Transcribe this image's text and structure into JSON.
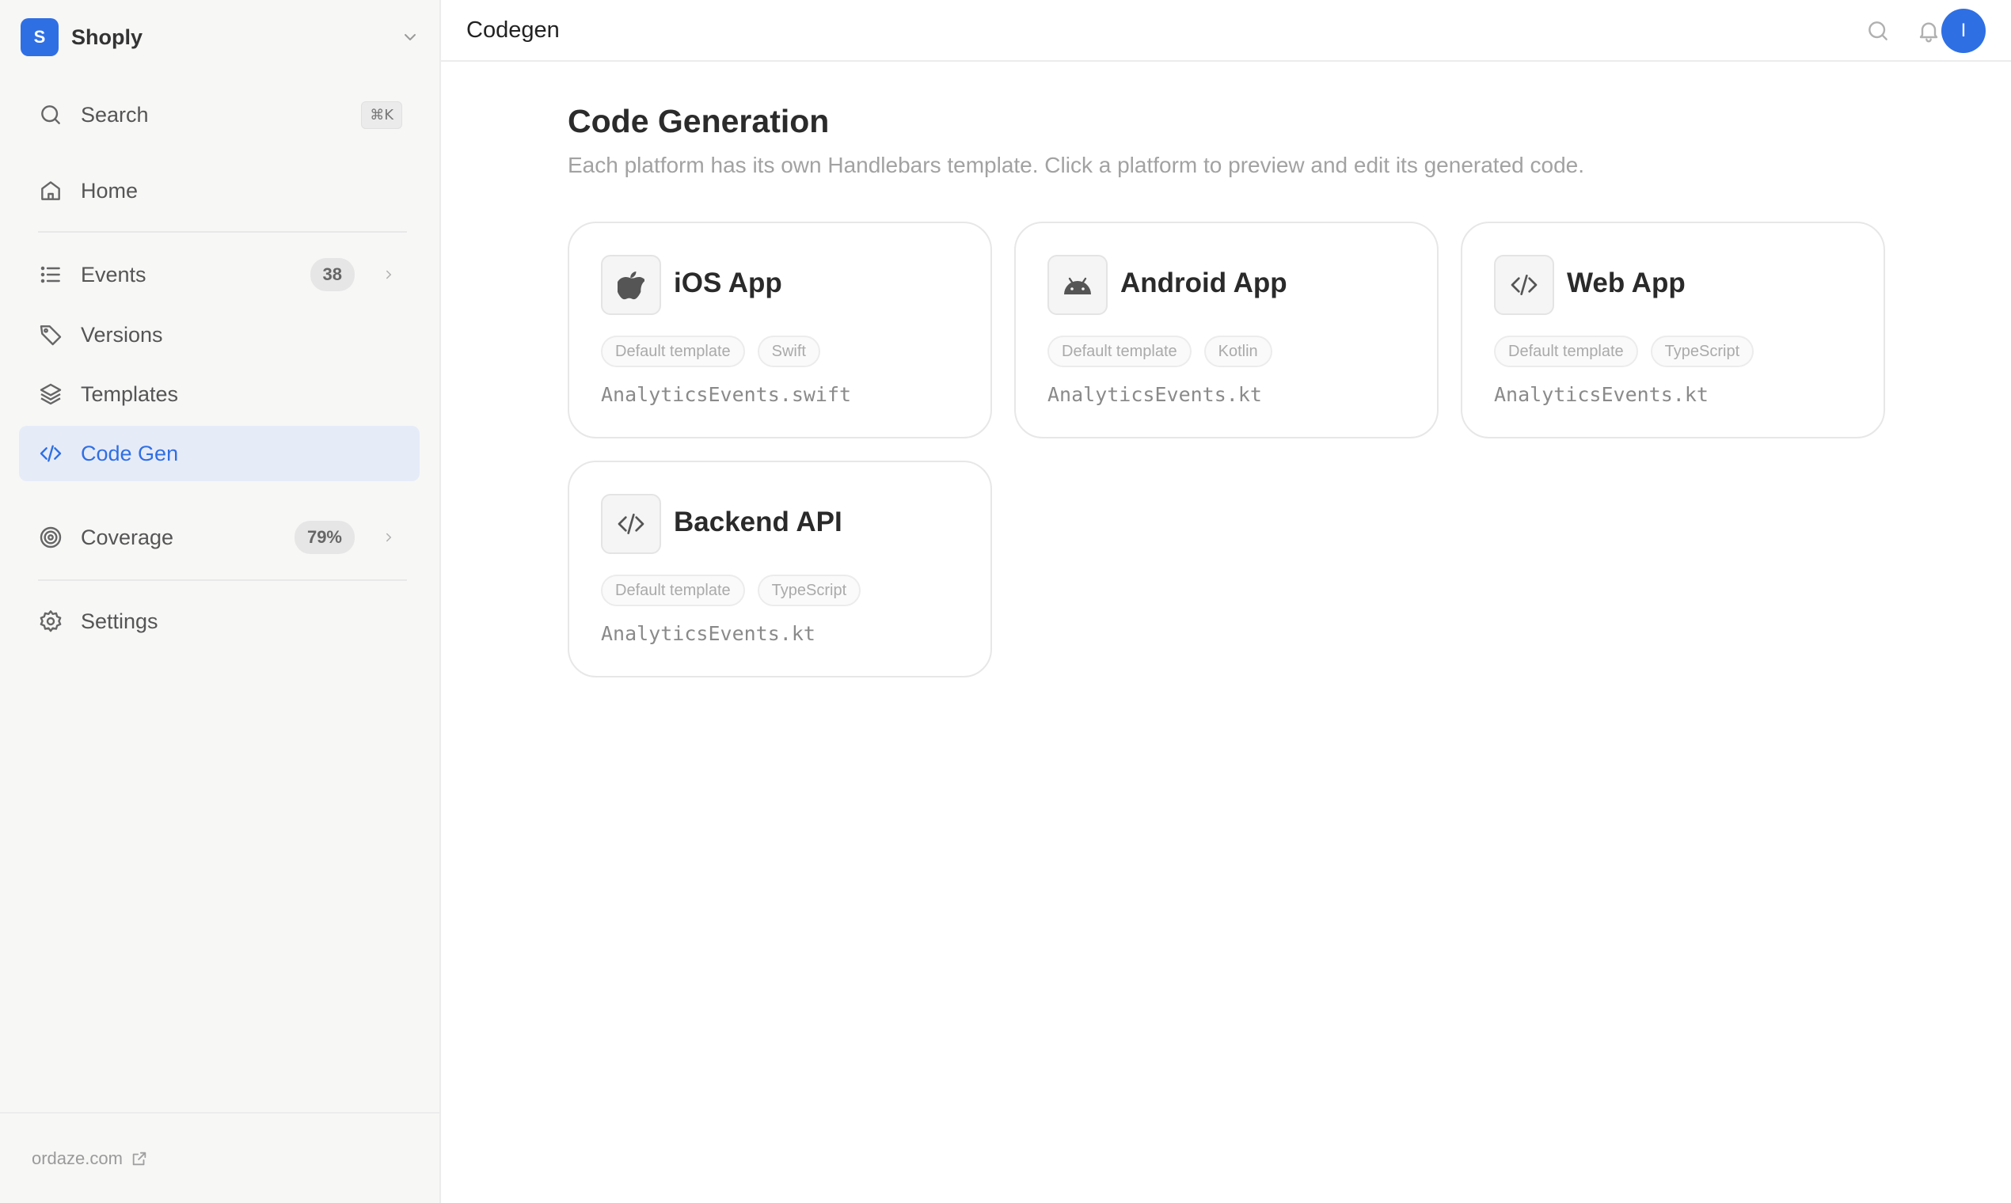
{
  "workspace": {
    "initial": "S",
    "name": "Shoply"
  },
  "sidebar": {
    "search": {
      "label": "Search",
      "shortcut": "⌘K"
    },
    "items": [
      {
        "id": "home",
        "label": "Home"
      },
      {
        "id": "events",
        "label": "Events",
        "badge": "38"
      },
      {
        "id": "versions",
        "label": "Versions"
      },
      {
        "id": "templates",
        "label": "Templates"
      },
      {
        "id": "codegen",
        "label": "Code Gen",
        "active": true
      },
      {
        "id": "coverage",
        "label": "Coverage",
        "badge": "79%"
      },
      {
        "id": "settings",
        "label": "Settings"
      }
    ],
    "footer_link": "ordaze.com"
  },
  "header": {
    "title": "Codegen",
    "avatar_initial": "I"
  },
  "main": {
    "title": "Code Generation",
    "subtitle": "Each platform has its own Handlebars template. Click a platform to preview and edit its generated code.",
    "cards": [
      {
        "title": "iOS App",
        "icon": "apple-icon",
        "tags": [
          "Default template",
          "Swift"
        ],
        "file": "AnalyticsEvents.swift"
      },
      {
        "title": "Android App",
        "icon": "android-icon",
        "tags": [
          "Default template",
          "Kotlin"
        ],
        "file": "AnalyticsEvents.kt"
      },
      {
        "title": "Web App",
        "icon": "code-icon",
        "tags": [
          "Default template",
          "TypeScript"
        ],
        "file": "AnalyticsEvents.kt"
      },
      {
        "title": "Backend API",
        "icon": "code-icon",
        "tags": [
          "Default template",
          "TypeScript"
        ],
        "file": "AnalyticsEvents.kt"
      }
    ]
  },
  "colors": {
    "accent": "#2f6fe4",
    "active_bg": "#e6ebf8",
    "sidebar_bg": "#f7f7f6"
  }
}
